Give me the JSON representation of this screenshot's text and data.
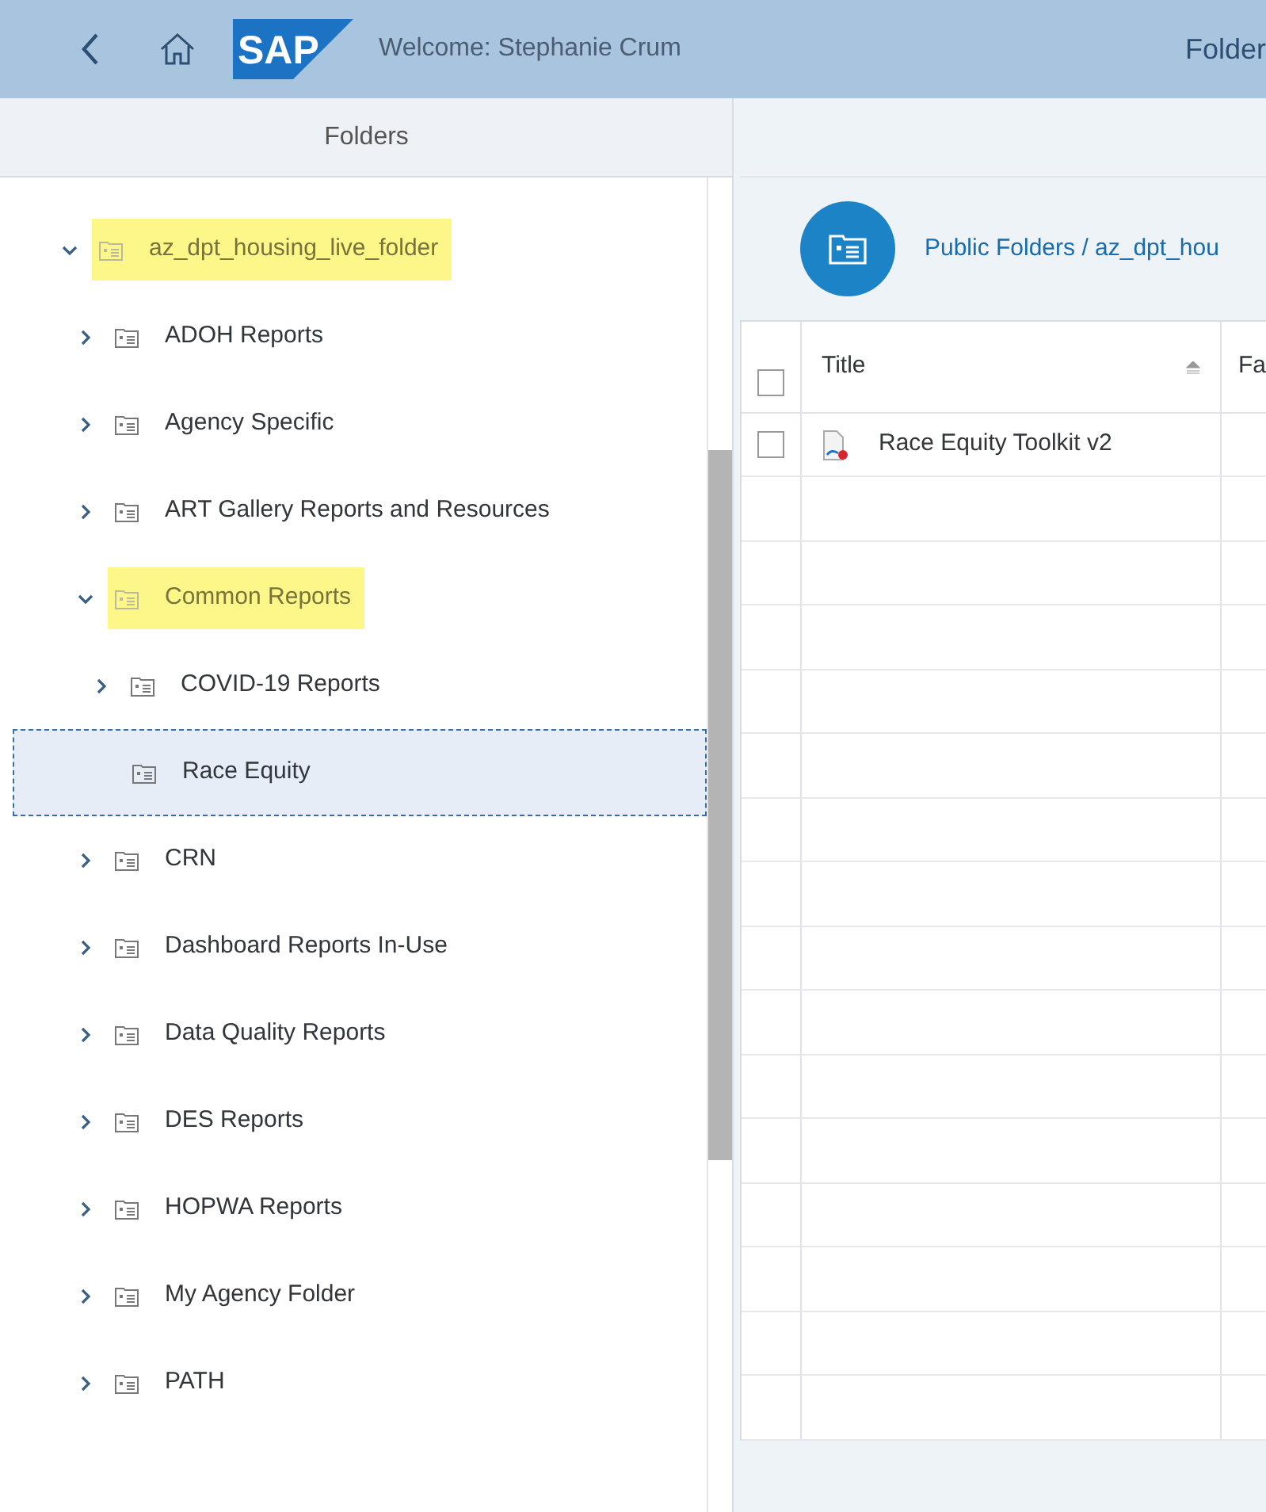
{
  "header": {
    "logo": "SAP",
    "welcome": "Welcome: Stephanie Crum",
    "title": "Folder"
  },
  "sidebar": {
    "title": "Folders",
    "tree": [
      {
        "label": "az_dpt_housing_live_folder",
        "expanded": true,
        "highlighted": true,
        "selected": false,
        "children": [
          {
            "label": "ADOH Reports",
            "expanded": false,
            "highlighted": false,
            "selected": false
          },
          {
            "label": "Agency Specific",
            "expanded": false,
            "highlighted": false,
            "selected": false
          },
          {
            "label": "ART Gallery Reports and Resources",
            "expanded": false,
            "highlighted": false,
            "selected": false
          },
          {
            "label": "Common Reports",
            "expanded": true,
            "highlighted": true,
            "selected": false,
            "children": [
              {
                "label": "COVID-19 Reports",
                "expanded": false,
                "highlighted": false,
                "selected": false
              },
              {
                "label": "Race Equity",
                "highlighted": false,
                "selected": true
              }
            ]
          },
          {
            "label": "CRN",
            "expanded": false,
            "highlighted": false,
            "selected": false
          },
          {
            "label": "Dashboard Reports In-Use",
            "expanded": false,
            "highlighted": false,
            "selected": false
          },
          {
            "label": "Data Quality Reports",
            "expanded": false,
            "highlighted": false,
            "selected": false
          },
          {
            "label": "DES Reports",
            "expanded": false,
            "highlighted": false,
            "selected": false
          },
          {
            "label": "HOPWA Reports",
            "expanded": false,
            "highlighted": false,
            "selected": false
          },
          {
            "label": "My Agency Folder",
            "expanded": false,
            "highlighted": false,
            "selected": false
          },
          {
            "label": "PATH",
            "expanded": false,
            "highlighted": false,
            "selected": false
          }
        ]
      }
    ]
  },
  "main": {
    "breadcrumb": "Public Folders / az_dpt_hou",
    "table": {
      "select_all_checked": false,
      "columns": [
        "Title",
        "Fa"
      ],
      "rows": [
        {
          "title": "Race Equity Toolkit v2",
          "checked": false
        }
      ]
    }
  }
}
